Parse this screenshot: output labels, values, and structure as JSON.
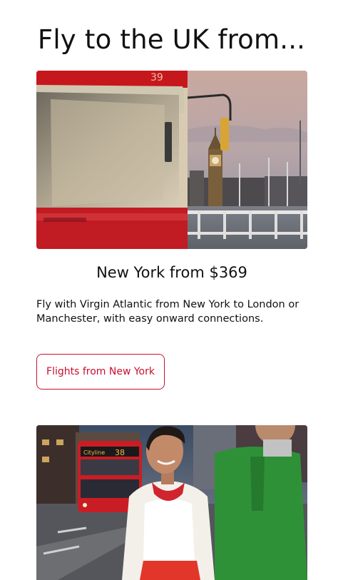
{
  "heading": "Fly to the UK from...",
  "cards": [
    {
      "title": "New York from $369",
      "description": "Fly with Virgin Atlantic from New York to London or Manchester, with easy onward connections.",
      "cta_label": "Flights from New York",
      "bus_number": "38"
    }
  ],
  "colors": {
    "accent": "#c8102e",
    "text": "#111111"
  }
}
